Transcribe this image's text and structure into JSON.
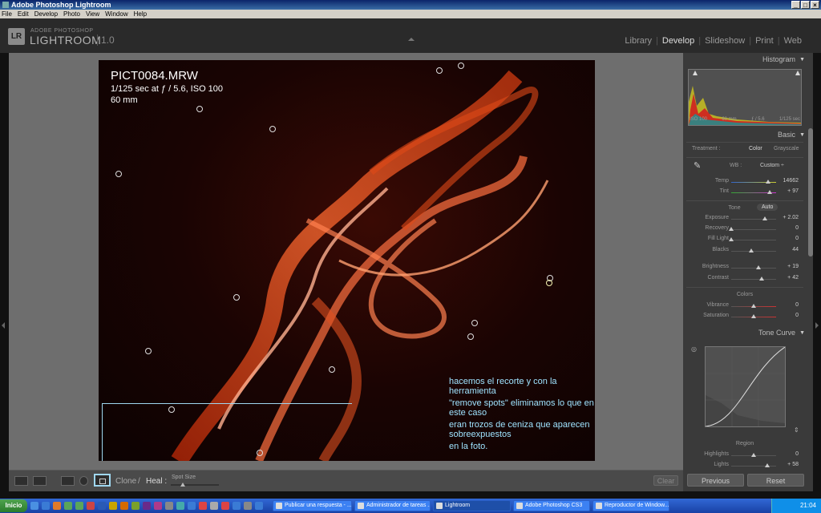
{
  "window": {
    "title": "Adobe Photoshop Lightroom",
    "controls": [
      "_",
      "□",
      "×"
    ]
  },
  "menu": [
    "File",
    "Edit",
    "Develop",
    "Photo",
    "View",
    "Window",
    "Help"
  ],
  "brand": {
    "badge": "LR",
    "small": "ADOBE PHOTOSHOP",
    "big": "LIGHTROOM",
    "version": "1.0"
  },
  "modules": [
    "Library",
    "Develop",
    "Slideshow",
    "Print",
    "Web"
  ],
  "active_module": "Develop",
  "photo_info": {
    "filename": "PICT0084.MRW",
    "exposure": "1/125 sec at ƒ / 5.6, ISO 100",
    "focal": "60 mm"
  },
  "caption": [
    "hacemos el recorte y con la herramienta",
    "\"remove spots\" eliminamos lo que en este caso",
    "eran trozos de ceniza que aparecen sobreexpuestos",
    "en la foto."
  ],
  "toolbar": {
    "clone": "Clone",
    "separator": "/",
    "heal": "Heal :",
    "spot_size": "Spot Size",
    "clear": "Clear"
  },
  "histogram": {
    "title": "Histogram",
    "meta": [
      "ISO 100",
      "60 mm",
      "ƒ / 5.6",
      "1/125 sec"
    ]
  },
  "basic": {
    "title": "Basic",
    "treatment_label": "Treatment :",
    "color": "Color",
    "grayscale": "Grayscale",
    "wb_label": "WB :",
    "wb_value": "Custom ÷",
    "tone_label": "Tone",
    "auto": "Auto",
    "colors_label": "Colors",
    "sliders": {
      "temp": {
        "label": "Temp",
        "value": "14662",
        "level": 0.82
      },
      "tint": {
        "label": "Tint",
        "value": "+ 97",
        "level": 0.85
      },
      "exposure": {
        "label": "Exposure",
        "value": "+ 2.02",
        "level": 0.75
      },
      "recovery": {
        "label": "Recovery",
        "value": "0",
        "level": 0.0
      },
      "fill_light": {
        "label": "Fill Light",
        "value": "0",
        "level": 0.0
      },
      "blacks": {
        "label": "Blacks",
        "value": "44",
        "level": 0.45
      },
      "brightness": {
        "label": "Brightness",
        "value": "+ 19",
        "level": 0.6
      },
      "contrast": {
        "label": "Contrast",
        "value": "+ 42",
        "level": 0.68
      },
      "vibrance": {
        "label": "Vibrance",
        "value": "0",
        "level": 0.5
      },
      "saturation": {
        "label": "Saturation",
        "value": "0",
        "level": 0.5
      }
    }
  },
  "tone_curve": {
    "title": "Tone Curve",
    "region_label": "Region",
    "highlights": {
      "label": "Highlights",
      "value": "0",
      "level": 0.5
    },
    "lights": {
      "label": "Lights",
      "value": "+ 58",
      "level": 0.8
    }
  },
  "buttons": {
    "previous": "Previous",
    "reset": "Reset"
  },
  "taskbar": {
    "start": "Inicio",
    "tasks": [
      "Publicar una respuesta - ...",
      "Administrador de tareas ...",
      "Lightroom",
      "Adobe Photoshop CS3",
      "Reproductor de Window..."
    ],
    "lang": "ES",
    "clock": "21:04"
  },
  "colors": {
    "accent_callout": "#9fd7f0",
    "caption_text": "#9fe3ff",
    "panel_bg": "#3a3a3a"
  }
}
